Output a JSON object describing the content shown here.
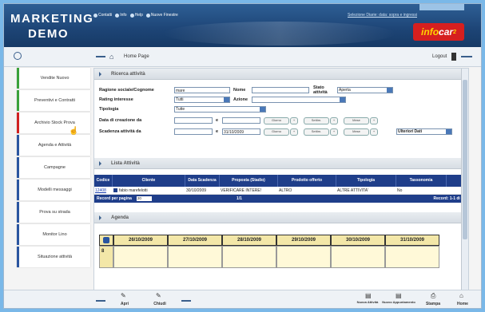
{
  "app": {
    "brand_line1": "MARKETING",
    "brand_line2": "DEMO",
    "logo_text": "info",
    "logo_accent": "car",
    "logo_version": "2"
  },
  "topnav": {
    "items": [
      {
        "icon": "contacts-icon",
        "label": "Contatti"
      },
      {
        "icon": "info-icon",
        "label": "Info"
      },
      {
        "icon": "help-icon",
        "label": "Help"
      },
      {
        "icon": "news-icon",
        "label": "Nuove Finestre"
      }
    ],
    "right_text": "Selezione Diarie: data: sopra e ingressi"
  },
  "toolbar": {
    "home_label": "Home Page",
    "logout_label": "Logout"
  },
  "sidebar": {
    "items": [
      {
        "label": "Vendite Nuovo",
        "color": "green"
      },
      {
        "label": "Preventivi e Contratti",
        "color": "green"
      },
      {
        "label": "Archivio Stock Prova",
        "color": "red"
      },
      {
        "label": "Agenda e Attività",
        "color": "blue"
      },
      {
        "label": "Campagne",
        "color": "blue"
      },
      {
        "label": "Modelli messaggi",
        "color": "blue"
      },
      {
        "label": "Prova su strada",
        "color": "blue"
      },
      {
        "label": "Monitor Lino",
        "color": "blue"
      },
      {
        "label": "Situazione attività",
        "color": "blue"
      }
    ]
  },
  "search": {
    "title": "Ricerca attività",
    "fields": {
      "ragione_label": "Ragione sociale/Cognome",
      "ragione_value": "mare",
      "nome_label": "Nome",
      "stato_label": "Stato attività",
      "stato_value": "Aperta",
      "rating_label": "Rating interesse",
      "rating_value": "Tutti",
      "azione_label": "Azione",
      "tipologia_label": "Tipologia",
      "tipologia_value": "Tutte",
      "data_creazione_label": "Data di creazione da",
      "e_label": "e",
      "scadenza_label": "Scadenza attività da",
      "scadenza_to_value": "31/10/2009",
      "filter_buttons": [
        "Giorno",
        "Settim.",
        "Mese"
      ],
      "other_select": "Ulteriori Dati"
    }
  },
  "list": {
    "title": "Lista Attività",
    "columns": [
      "Codice",
      "Cliente",
      "Data Scadenza",
      "Proposta (Stadio)",
      "Prodotto offerto",
      "Tipologia",
      "Tassonomia"
    ],
    "rows": [
      {
        "code": "12408",
        "cliente": "fabio marefelotti",
        "data": "30/10/2009",
        "proposta": "VERIFICARE INTERE!",
        "prodotto": "ALTRO",
        "tipologia": "ALTRE ATTIVITA'",
        "tassonomia": "No"
      }
    ],
    "pager": {
      "label": "Record per pagina",
      "per_page": "20",
      "page_info": "1/1",
      "records": "Record: 1-1 di 1"
    }
  },
  "agenda": {
    "title": "Agenda",
    "dates": [
      "26/10/2009",
      "27/10/2009",
      "28/10/2009",
      "29/10/2009",
      "30/10/2009",
      "31/10/2009"
    ],
    "first_col": "8"
  },
  "bottombar": {
    "items": [
      {
        "icon": "pen-icon",
        "label": "Apri"
      },
      {
        "icon": "pen-icon",
        "label": "Chiudi"
      },
      {
        "icon": "new-activity-icon",
        "label": "Nuova Attività"
      },
      {
        "icon": "new-action-icon",
        "label": "Nuovo Appuntamento"
      },
      {
        "icon": "print-icon",
        "label": "Stampa"
      },
      {
        "icon": "home-icon",
        "label": "Home"
      }
    ]
  }
}
